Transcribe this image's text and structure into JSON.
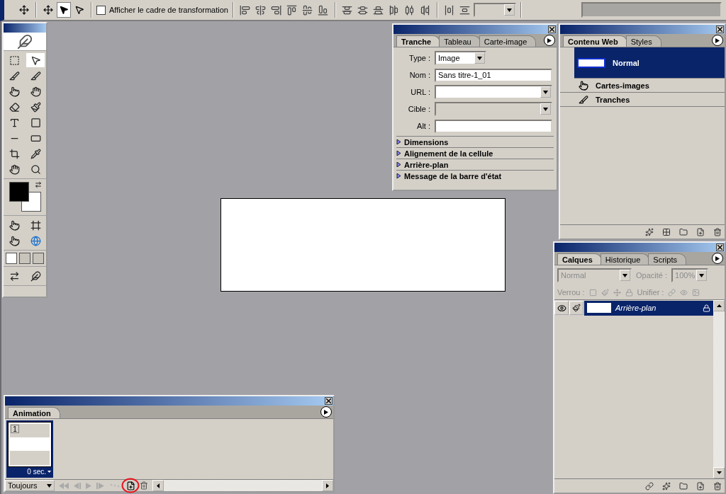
{
  "options_bar": {
    "modes": [
      {
        "selected": false
      },
      {
        "selected": true
      },
      {
        "selected": false
      }
    ],
    "show_transform": {
      "label": "Afficher le cadre de transformation",
      "checked": false
    }
  },
  "toolbox": {
    "tools": [
      {
        "selected": false
      },
      {
        "selected": true
      },
      {
        "selected": false
      },
      {
        "selected": false
      },
      {
        "selected": false
      },
      {
        "selected": false
      },
      {
        "selected": false
      },
      {
        "selected": false
      },
      {
        "selected": false
      },
      {
        "selected": false
      },
      {
        "selected": false
      },
      {
        "selected": false
      },
      {
        "selected": false
      },
      {
        "selected": false
      },
      {
        "selected": false
      },
      {
        "selected": false
      }
    ],
    "screen_modes": [
      {
        "selected": true
      },
      {
        "selected": false
      },
      {
        "selected": false
      }
    ]
  },
  "slice_panel": {
    "tabs": [
      {
        "label": "Tranche",
        "selected": true
      },
      {
        "label": "Tableau",
        "selected": false
      },
      {
        "label": "Carte-image",
        "selected": false
      }
    ],
    "fields": [
      {
        "label": "Type :",
        "kind": "select",
        "value": "Image"
      },
      {
        "label": "Nom :",
        "kind": "text",
        "value": "Sans titre-1_01"
      },
      {
        "label": "URL :",
        "kind": "combo",
        "disabled": false
      },
      {
        "label": "Cible :",
        "kind": "combo",
        "disabled": true
      },
      {
        "label": "Alt :",
        "kind": "text"
      }
    ],
    "sections": [
      {
        "label": "Dimensions",
        "expanded": false
      },
      {
        "label": "Alignement de la cellule",
        "expanded": false
      },
      {
        "label": "Arrière-plan",
        "expanded": false
      },
      {
        "label": "Message de la barre d'état",
        "expanded": false
      }
    ]
  },
  "web_content_panel": {
    "tabs": [
      {
        "label": "Contenu Web",
        "selected": true
      },
      {
        "label": "Styles",
        "selected": false
      }
    ],
    "items": [
      {
        "label": "Normal",
        "kind": "state",
        "selected": true
      },
      {
        "label": "Cartes-images",
        "kind": "imagemaps",
        "selected": false
      },
      {
        "label": "Tranches",
        "kind": "slices",
        "selected": false
      }
    ]
  },
  "layers_panel": {
    "tabs": [
      {
        "label": "Calques",
        "selected": true
      },
      {
        "label": "Historique",
        "selected": false
      },
      {
        "label": "Scripts",
        "selected": false
      }
    ],
    "blend_mode": "Normal",
    "opacity_label": "Opacité :",
    "opacity": "100%",
    "lock_label": "Verrou :",
    "unify_label": "Unifier :",
    "layers": [
      {
        "name": "Arrière-plan",
        "visible": true,
        "selected": true,
        "locked": true
      }
    ]
  },
  "animation_panel": {
    "tabs": [
      {
        "label": "Animation",
        "selected": true
      }
    ],
    "frames": [
      {
        "number": "1",
        "delay": "0 sec.",
        "selected": true
      }
    ],
    "loop": "Toujours"
  }
}
